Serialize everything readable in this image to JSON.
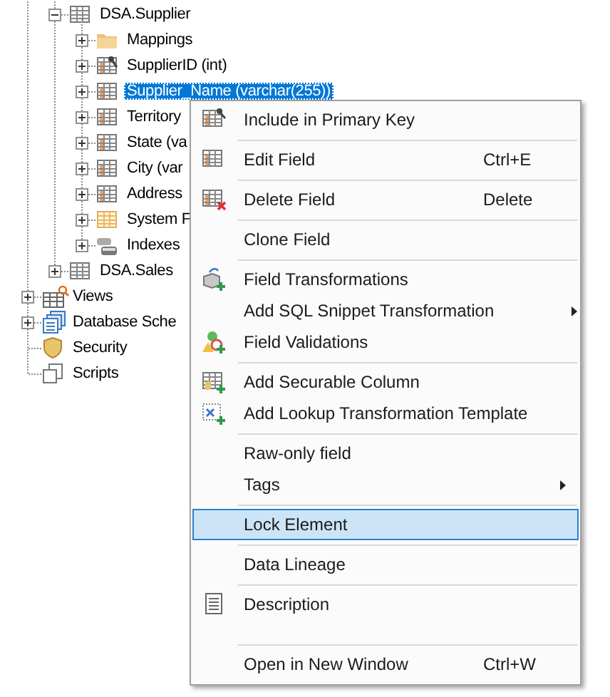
{
  "tree": {
    "items": [
      {
        "children": [
          {
            "label": "DSA.Supplier",
            "kind": "table",
            "expanded": true,
            "selected": false,
            "children": [
              {
                "label": "Mappings",
                "kind": "folder",
                "expanded": false,
                "selected": false
              },
              {
                "label": "SupplierID (int)",
                "kind": "key-field",
                "expanded": false,
                "selected": false
              },
              {
                "label": "Supplier_Name (varchar(255))",
                "kind": "field",
                "expanded": false,
                "selected": true
              },
              {
                "label": "Territory",
                "kind": "field",
                "expanded": false,
                "selected": false
              },
              {
                "label": "State (va",
                "kind": "field",
                "expanded": false,
                "selected": false
              },
              {
                "label": "City (var",
                "kind": "field",
                "expanded": false,
                "selected": false
              },
              {
                "label": "Address",
                "kind": "field",
                "expanded": false,
                "selected": false
              },
              {
                "label": "System F",
                "kind": "system-fields",
                "expanded": false,
                "selected": false
              },
              {
                "label": "Indexes",
                "kind": "indexes",
                "expanded": false,
                "selected": false
              }
            ]
          },
          {
            "label": "DSA.Sales",
            "kind": "table",
            "expanded": false,
            "selected": false
          }
        ]
      },
      {
        "label": "Views",
        "kind": "views",
        "expanded": false,
        "selected": false
      },
      {
        "label": "Database Sche",
        "kind": "schemas",
        "expanded": false,
        "selected": false
      },
      {
        "label": "Security",
        "kind": "security",
        "selected": false
      },
      {
        "label": "Scripts",
        "kind": "scripts",
        "selected": false
      }
    ]
  },
  "context_menu": {
    "items": [
      {
        "kind": "item",
        "label": "Include in Primary Key",
        "selected": false
      },
      {
        "kind": "separator"
      },
      {
        "kind": "item",
        "label": "Edit Field",
        "shortcut": "Ctrl+E",
        "selected": false
      },
      {
        "kind": "separator"
      },
      {
        "kind": "item",
        "label": "Delete Field",
        "shortcut": "Delete",
        "selected": false
      },
      {
        "kind": "separator"
      },
      {
        "kind": "item",
        "label": "Clone Field",
        "selected": false
      },
      {
        "kind": "separator"
      },
      {
        "kind": "item",
        "label": "Field Transformations",
        "selected": false
      },
      {
        "kind": "item",
        "label": "Add SQL Snippet Transformation",
        "submenu": true,
        "selected": false
      },
      {
        "kind": "item",
        "label": "Field Validations",
        "selected": false
      },
      {
        "kind": "separator"
      },
      {
        "kind": "item",
        "label": "Add Securable Column",
        "selected": false
      },
      {
        "kind": "item",
        "label": "Add Lookup Transformation Template",
        "selected": false
      },
      {
        "kind": "separator"
      },
      {
        "kind": "item",
        "label": "Raw-only field",
        "selected": false
      },
      {
        "kind": "item",
        "label": "Tags",
        "submenu": true,
        "selected": false
      },
      {
        "kind": "separator"
      },
      {
        "kind": "item",
        "label": "Lock Element",
        "selected": true
      },
      {
        "kind": "separator"
      },
      {
        "kind": "item",
        "label": "Data Lineage",
        "selected": false
      },
      {
        "kind": "separator"
      },
      {
        "kind": "item",
        "label": "Description",
        "selected": false
      },
      {
        "kind": "spacer"
      },
      {
        "kind": "separator"
      },
      {
        "kind": "item",
        "label": "Open in New Window",
        "shortcut": "Ctrl+W",
        "selected": false
      }
    ]
  }
}
